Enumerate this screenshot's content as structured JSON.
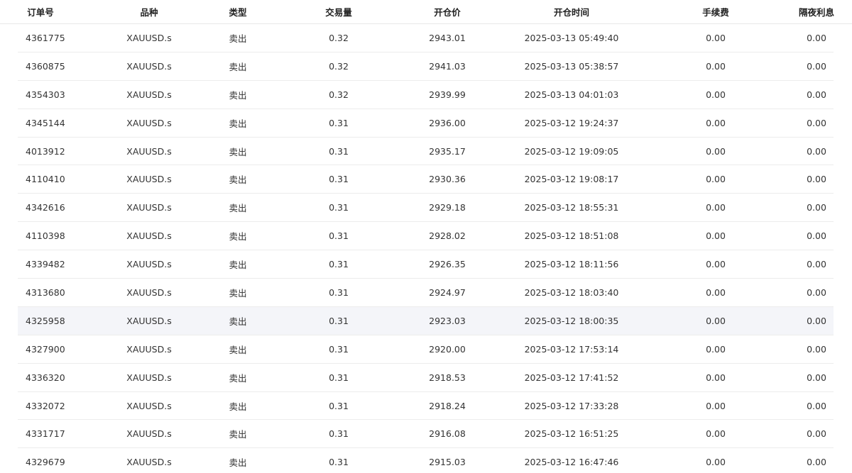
{
  "table": {
    "headers": {
      "order": "订单号",
      "symbol": "品种",
      "type": "类型",
      "volume": "交易量",
      "open_price": "开仓价",
      "open_time": "开仓时间",
      "fee": "手续费",
      "swap": "隔夜利息"
    },
    "rows": [
      {
        "order": "4361775",
        "symbol": "XAUUSD.s",
        "type": "卖出",
        "volume": "0.32",
        "open_price": "2943.01",
        "open_time": "2025-03-13 05:49:40",
        "fee": "0.00",
        "swap": "0.00"
      },
      {
        "order": "4360875",
        "symbol": "XAUUSD.s",
        "type": "卖出",
        "volume": "0.32",
        "open_price": "2941.03",
        "open_time": "2025-03-13 05:38:57",
        "fee": "0.00",
        "swap": "0.00"
      },
      {
        "order": "4354303",
        "symbol": "XAUUSD.s",
        "type": "卖出",
        "volume": "0.32",
        "open_price": "2939.99",
        "open_time": "2025-03-13 04:01:03",
        "fee": "0.00",
        "swap": "0.00"
      },
      {
        "order": "4345144",
        "symbol": "XAUUSD.s",
        "type": "卖出",
        "volume": "0.31",
        "open_price": "2936.00",
        "open_time": "2025-03-12 19:24:37",
        "fee": "0.00",
        "swap": "0.00"
      },
      {
        "order": "4013912",
        "symbol": "XAUUSD.s",
        "type": "卖出",
        "volume": "0.31",
        "open_price": "2935.17",
        "open_time": "2025-03-12 19:09:05",
        "fee": "0.00",
        "swap": "0.00"
      },
      {
        "order": "4110410",
        "symbol": "XAUUSD.s",
        "type": "卖出",
        "volume": "0.31",
        "open_price": "2930.36",
        "open_time": "2025-03-12 19:08:17",
        "fee": "0.00",
        "swap": "0.00"
      },
      {
        "order": "4342616",
        "symbol": "XAUUSD.s",
        "type": "卖出",
        "volume": "0.31",
        "open_price": "2929.18",
        "open_time": "2025-03-12 18:55:31",
        "fee": "0.00",
        "swap": "0.00"
      },
      {
        "order": "4110398",
        "symbol": "XAUUSD.s",
        "type": "卖出",
        "volume": "0.31",
        "open_price": "2928.02",
        "open_time": "2025-03-12 18:51:08",
        "fee": "0.00",
        "swap": "0.00"
      },
      {
        "order": "4339482",
        "symbol": "XAUUSD.s",
        "type": "卖出",
        "volume": "0.31",
        "open_price": "2926.35",
        "open_time": "2025-03-12 18:11:56",
        "fee": "0.00",
        "swap": "0.00"
      },
      {
        "order": "4313680",
        "symbol": "XAUUSD.s",
        "type": "卖出",
        "volume": "0.31",
        "open_price": "2924.97",
        "open_time": "2025-03-12 18:03:40",
        "fee": "0.00",
        "swap": "0.00"
      },
      {
        "order": "4325958",
        "symbol": "XAUUSD.s",
        "type": "卖出",
        "volume": "0.31",
        "open_price": "2923.03",
        "open_time": "2025-03-12 18:00:35",
        "fee": "0.00",
        "swap": "0.00"
      },
      {
        "order": "4327900",
        "symbol": "XAUUSD.s",
        "type": "卖出",
        "volume": "0.31",
        "open_price": "2920.00",
        "open_time": "2025-03-12 17:53:14",
        "fee": "0.00",
        "swap": "0.00"
      },
      {
        "order": "4336320",
        "symbol": "XAUUSD.s",
        "type": "卖出",
        "volume": "0.31",
        "open_price": "2918.53",
        "open_time": "2025-03-12 17:41:52",
        "fee": "0.00",
        "swap": "0.00"
      },
      {
        "order": "4332072",
        "symbol": "XAUUSD.s",
        "type": "卖出",
        "volume": "0.31",
        "open_price": "2918.24",
        "open_time": "2025-03-12 17:33:28",
        "fee": "0.00",
        "swap": "0.00"
      },
      {
        "order": "4331717",
        "symbol": "XAUUSD.s",
        "type": "卖出",
        "volume": "0.31",
        "open_price": "2916.08",
        "open_time": "2025-03-12 16:51:25",
        "fee": "0.00",
        "swap": "0.00"
      },
      {
        "order": "4329679",
        "symbol": "XAUUSD.s",
        "type": "卖出",
        "volume": "0.31",
        "open_price": "2915.03",
        "open_time": "2025-03-12 16:47:46",
        "fee": "0.00",
        "swap": "0.00"
      }
    ],
    "hover_row_index": 10
  },
  "colors": {
    "header_text": "#222222",
    "cell_text": "#333333",
    "row_divider": "#ececec",
    "hover_background": "#f4f5f9"
  }
}
